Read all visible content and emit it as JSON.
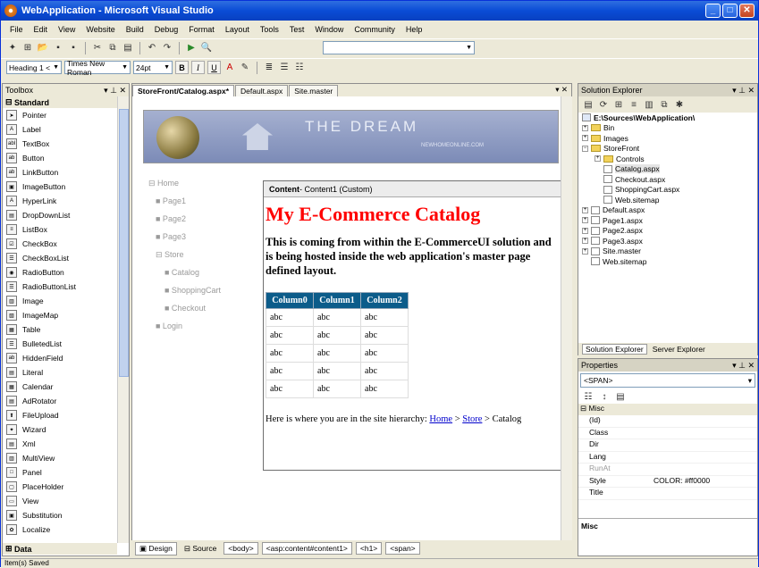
{
  "window": {
    "title": "WebApplication - Microsoft Visual Studio"
  },
  "menu": [
    "File",
    "Edit",
    "View",
    "Website",
    "Build",
    "Debug",
    "Format",
    "Layout",
    "Tools",
    "Test",
    "Window",
    "Community",
    "Help"
  ],
  "format_toolbar": {
    "block_format": "Heading 1 <",
    "font_name": "Times New Roman",
    "font_size": "24pt",
    "bold": "B",
    "italic": "I",
    "underline": "U"
  },
  "toolbox": {
    "title": "Toolbox",
    "sections": {
      "standard": "Standard",
      "data": "Data"
    },
    "items": [
      "Pointer",
      "Label",
      "TextBox",
      "Button",
      "LinkButton",
      "ImageButton",
      "HyperLink",
      "DropDownList",
      "ListBox",
      "CheckBox",
      "CheckBoxList",
      "RadioButton",
      "RadioButtonList",
      "Image",
      "ImageMap",
      "Table",
      "BulletedList",
      "HiddenField",
      "Literal",
      "Calendar",
      "AdRotator",
      "FileUpload",
      "Wizard",
      "Xml",
      "MultiView",
      "Panel",
      "PlaceHolder",
      "View",
      "Substitution",
      "Localize"
    ]
  },
  "editor": {
    "tabs": [
      "StoreFront/Catalog.aspx*",
      "Default.aspx",
      "Site.master"
    ],
    "banner": {
      "title": "THE DREAM",
      "site": "NEWHOMEONLINE.COM"
    },
    "nav": [
      "⊟ Home",
      "■ Page1",
      "■ Page2",
      "■ Page3",
      "⊟ Store",
      "■ Catalog",
      "■ ShoppingCart",
      "■ Checkout",
      "■ Login"
    ],
    "content_header_bold": "Content",
    "content_header_rest": " - Content1 (Custom)",
    "heading": "My E-Commerce Catalog",
    "paragraph": "This is coming from within the E-CommerceUI solution and is being hosted inside the web application's master page defined layout.",
    "grid": {
      "columns": [
        "Column0",
        "Column1",
        "Column2"
      ],
      "rows": [
        [
          "abc",
          "abc",
          "abc"
        ],
        [
          "abc",
          "abc",
          "abc"
        ],
        [
          "abc",
          "abc",
          "abc"
        ],
        [
          "abc",
          "abc",
          "abc"
        ],
        [
          "abc",
          "abc",
          "abc"
        ]
      ]
    },
    "breadcrumb": {
      "prefix": "Here is where you are in the site hierarchy: ",
      "home": "Home",
      "sep": " > ",
      "store": "Store",
      "current": "Catalog"
    }
  },
  "editor_bar": {
    "design": "Design",
    "source": "Source",
    "tags": [
      "<body>",
      "<asp:content#content1>",
      "<h1>",
      "<span>"
    ]
  },
  "solution_explorer": {
    "title": "Solution Explorer",
    "root": "E:\\Sources\\WebApplication\\",
    "nodes": [
      "Bin",
      "Images",
      "StoreFront",
      "Controls",
      "Catalog.aspx",
      "Checkout.aspx",
      "ShoppingCart.aspx",
      "Web.sitemap",
      "Default.aspx",
      "Page1.aspx",
      "Page2.aspx",
      "Page3.aspx",
      "Site.master",
      "Web.sitemap"
    ],
    "tabs": [
      "Solution Explorer",
      "Server Explorer"
    ]
  },
  "properties": {
    "title": "Properties",
    "selected": "<SPAN>",
    "category": "Misc",
    "rows": [
      [
        "(Id)",
        ""
      ],
      [
        "Class",
        ""
      ],
      [
        "Dir",
        ""
      ],
      [
        "Lang",
        ""
      ],
      [
        "RunAt",
        ""
      ],
      [
        "Style",
        "COLOR: #ff0000"
      ],
      [
        "Title",
        ""
      ]
    ],
    "description_title": "Misc"
  },
  "status": "Item(s) Saved"
}
